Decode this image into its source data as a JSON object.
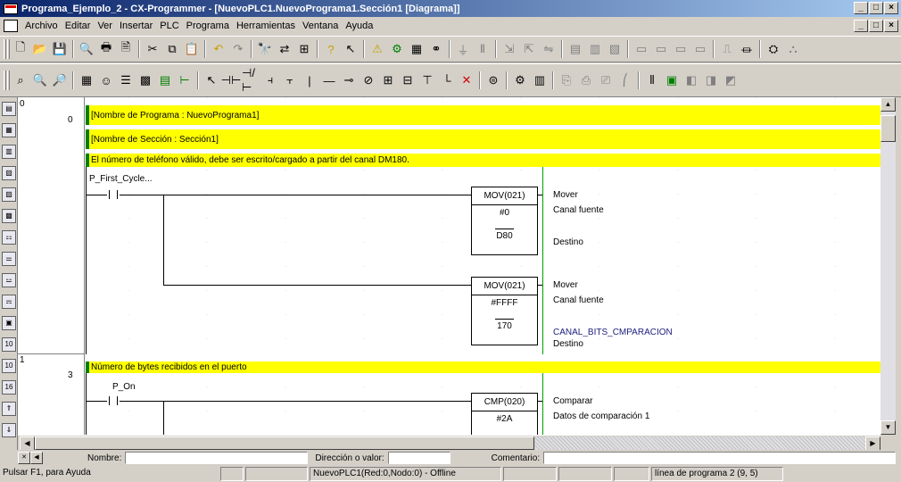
{
  "window": {
    "title": "Programa_Ejemplo_2 - CX-Programmer - [NuevoPLC1.NuevoPrograma1.Sección1 [Diagrama]]",
    "controls": [
      "_",
      "□",
      "×"
    ]
  },
  "menu": {
    "items": [
      "Archivo",
      "Editar",
      "Ver",
      "Insertar",
      "PLC",
      "Programa",
      "Herramientas",
      "Ventana",
      "Ayuda"
    ]
  },
  "editor": {
    "rung0_number": "0",
    "rung0_step": "0",
    "rung1_number": "1",
    "rung1_step": "3",
    "program_name": "[Nombre de Programa : NuevoPrograma1]",
    "section_name": "[Nombre de Sección : Sección1]",
    "comment_phone": "El número de teléfono válido, debe ser escrito/cargado a partir del canal DM180.",
    "comment_bytes": "Número de bytes recibidos en el puerto",
    "contact1_label": "P_First_Cycle...",
    "contact2_label": "P_On",
    "fb1": {
      "name": "MOV(021)",
      "op1": "#0",
      "op2": "D80",
      "desc1": "Mover",
      "desc2": "Canal fuente",
      "desc3": "Destino"
    },
    "fb2": {
      "name": "MOV(021)",
      "op1": "#FFFF",
      "op2": "170",
      "desc1": "Mover",
      "desc2": "Canal fuente",
      "desc3": "CANAL_BITS_CMPARACION",
      "desc4": "Destino"
    },
    "fb3": {
      "name": "CMP(020)",
      "op1": "#2A",
      "desc1": "Comparar",
      "desc2": "Datos de comparación 1"
    }
  },
  "info_bar": {
    "nombre_label": "Nombre:",
    "direccion_label": "Dirección o valor:",
    "comentario_label": "Comentario:"
  },
  "status_bar": {
    "help": "Pulsar F1, para Ayuda",
    "connection": "NuevoPLC1(Red:0,Nodo:0) - Offline",
    "position": "línea de programa 2 (9, 5)"
  },
  "colors": {
    "title_start": "#0a246a",
    "title_end": "#a6caf0",
    "comment_bg": "#ffff00",
    "rail": "#00a000"
  }
}
